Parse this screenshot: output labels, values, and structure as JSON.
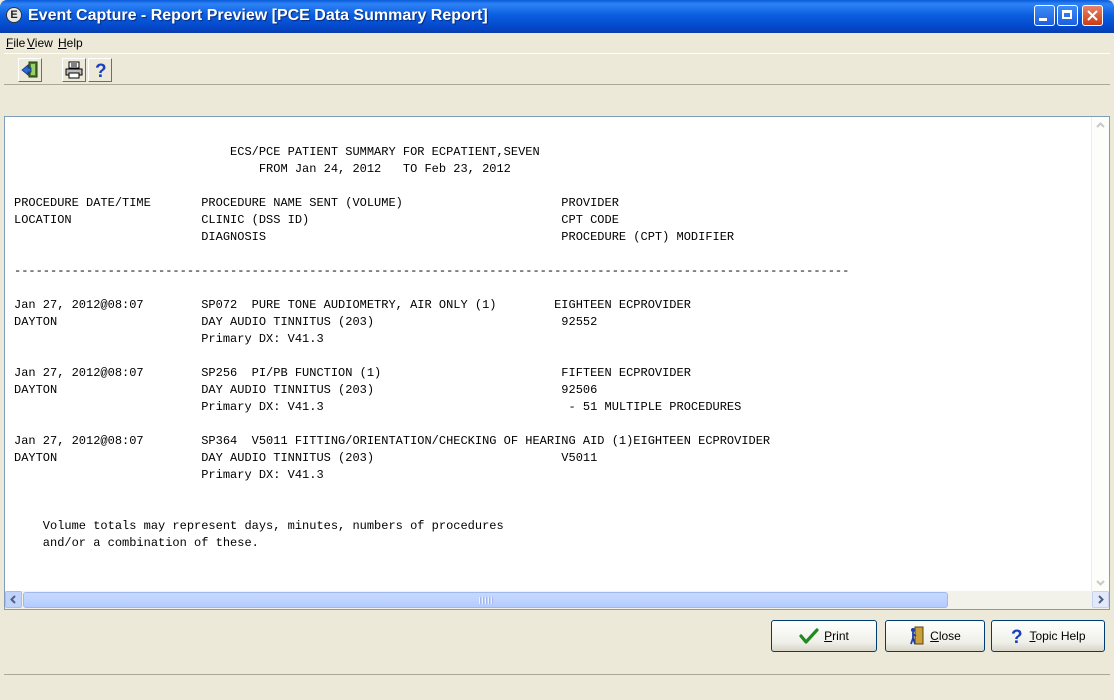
{
  "window": {
    "title": "Event Capture - Report Preview [PCE Data Summary Report]",
    "app_icon_glyph": "E"
  },
  "menu": [
    "File",
    "View",
    "Help"
  ],
  "toolbar": {
    "icons": [
      "exit-icon",
      "printer-icon",
      "help-icon"
    ],
    "help_glyph": "?"
  },
  "report": {
    "lines": [
      "                              ECS/PCE PATIENT SUMMARY FOR ECPATIENT,SEVEN",
      "                                  FROM Jan 24, 2012   TO Feb 23, 2012",
      "",
      "PROCEDURE DATE/TIME       PROCEDURE NAME SENT (VOLUME)                      PROVIDER",
      "LOCATION                  CLINIC (DSS ID)                                   CPT CODE",
      "                          DIAGNOSIS                                         PROCEDURE (CPT) MODIFIER",
      "",
      "--------------------------------------------------------------------------------------------------------------------",
      "",
      "Jan 27, 2012@08:07        SP072  PURE TONE AUDIOMETRY, AIR ONLY (1)        EIGHTEEN ECPROVIDER",
      "DAYTON                    DAY AUDIO TINNITUS (203)                          92552",
      "                          Primary DX: V41.3",
      "",
      "Jan 27, 2012@08:07        SP256  PI/PB FUNCTION (1)                         FIFTEEN ECPROVIDER",
      "DAYTON                    DAY AUDIO TINNITUS (203)                          92506",
      "                          Primary DX: V41.3                                  - 51 MULTIPLE PROCEDURES",
      "",
      "Jan 27, 2012@08:07        SP364  V5011 FITTING/ORIENTATION/CHECKING OF HEARING AID (1)EIGHTEEN ECPROVIDER",
      "DAYTON                    DAY AUDIO TINNITUS (203)                          V5011",
      "                          Primary DX: V41.3",
      "",
      "",
      "    Volume totals may represent days, minutes, numbers of procedures",
      "    and/or a combination of these."
    ]
  },
  "buttons": {
    "print": "Print",
    "close": "Close",
    "topic_help": "Topic Help",
    "help_glyph": "?"
  },
  "colors": {
    "titlebar": "#0a5bd9",
    "window_bg": "#ece9d8",
    "report_bg": "#ffffff"
  }
}
